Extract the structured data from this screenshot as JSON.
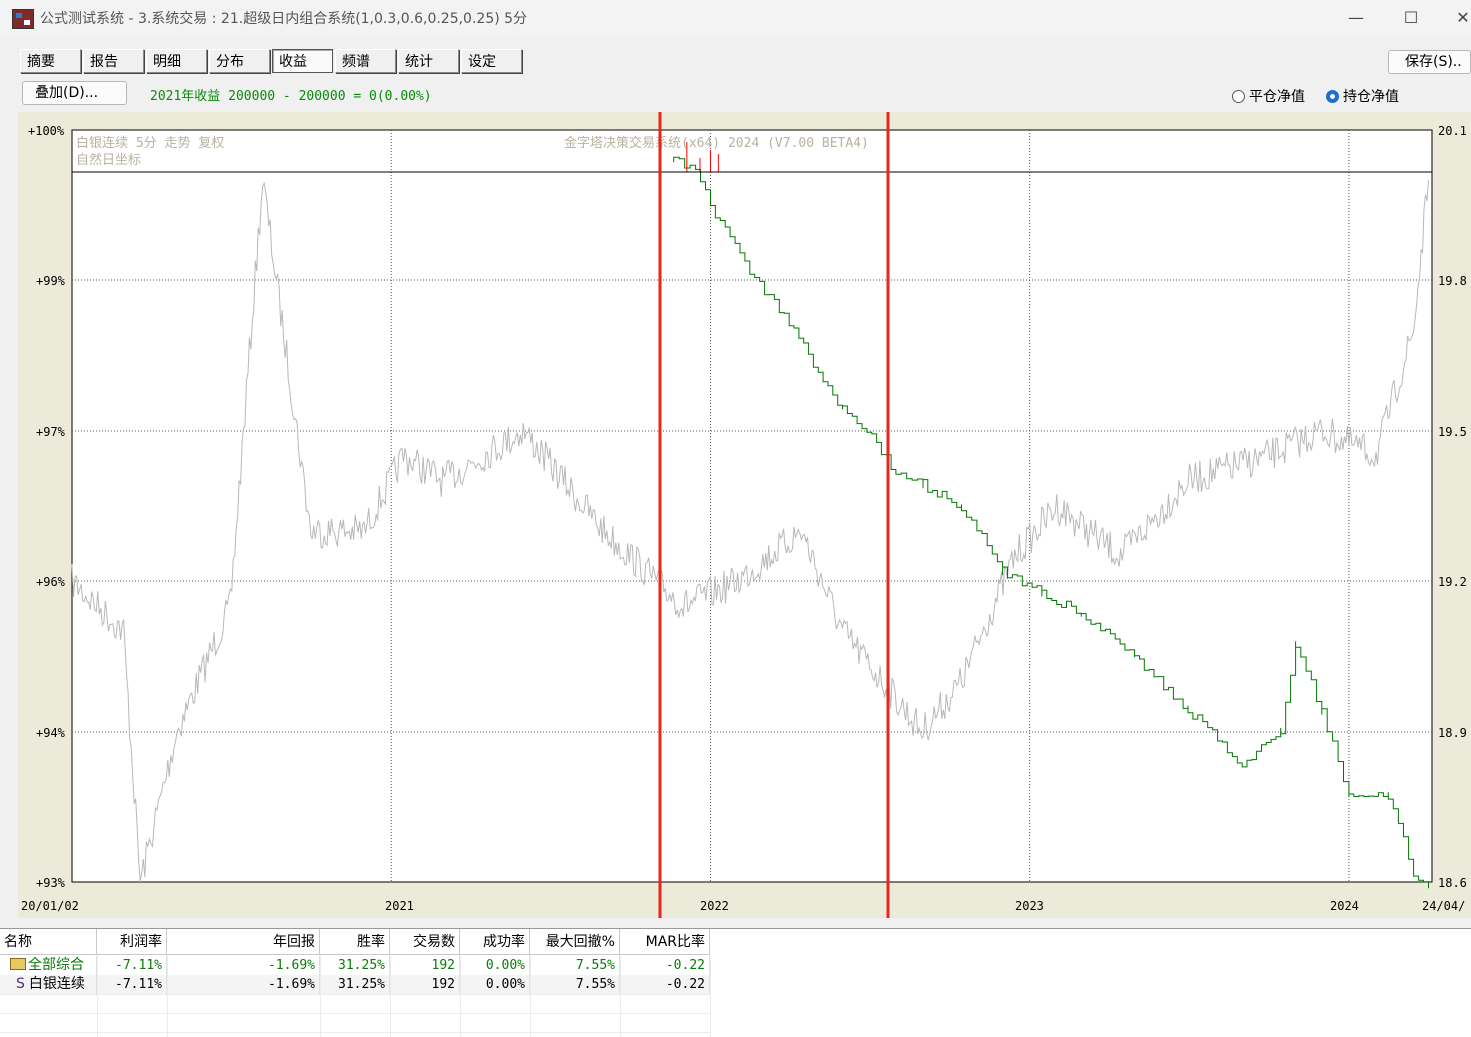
{
  "window": {
    "title": "公式测试系统 - 3.系统交易 : 21.超级日内组合系统(1,0.3,0.6,0.25,0.25) 5分"
  },
  "tabs": [
    {
      "label": "摘要",
      "active": false
    },
    {
      "label": "报告",
      "active": false
    },
    {
      "label": "明细",
      "active": false
    },
    {
      "label": "分布",
      "active": false
    },
    {
      "label": "收益",
      "active": true
    },
    {
      "label": "频谱",
      "active": false
    },
    {
      "label": "统计",
      "active": false
    },
    {
      "label": "设定",
      "active": false
    }
  ],
  "toolbar": {
    "save_label": "保存(S)..",
    "overlay_label": "叠加(D)...",
    "return_text": "2021年收益 200000 - 200000 = 0(0.00%)",
    "radio_close_label": "平仓净值",
    "radio_hold_label": "持仓净值",
    "radio_selected": "持仓净值"
  },
  "chart": {
    "watermark_line1": "白银连续 5分 走势 复权",
    "watermark_line2": "自然日坐标",
    "watermark_center": "金字塔决策交易系统(x64) 2024 (V7.00 BETA4)",
    "left_ticks": [
      "+100%",
      "+99%",
      "+97%",
      "+96%",
      "+94%",
      "+93%"
    ],
    "right_ticks": [
      "20.1",
      "19.8",
      "19.5",
      "19.2",
      "18.9",
      "18.6"
    ],
    "x_start": "20/01/02",
    "x_end": "24/04/",
    "x_ticks": [
      "2021",
      "2022",
      "2023",
      "2024"
    ],
    "colors": {
      "equity": "#007800",
      "price": "#b8b8b8",
      "highlight": "#e8261e",
      "spike": "#ff0000"
    }
  },
  "chart_data": {
    "type": "line",
    "series": [
      {
        "name": "equity (持仓净值)",
        "x": [
          "2021-11-20",
          "2021-12-15",
          "2022-01-01",
          "2022-02-15",
          "2022-04-01",
          "2022-06-01",
          "2022-07-10",
          "2022-08-01",
          "2022-09-01",
          "2022-10-15",
          "2022-12-01",
          "2023-01-15",
          "2023-03-01",
          "2023-05-01",
          "2023-07-01",
          "2023-09-01",
          "2023-10-15",
          "2023-11-01",
          "2023-12-01",
          "2024-01-01",
          "2024-02-15",
          "2024-03-15",
          "2024-04-01"
        ],
        "values": [
          99.7,
          99.65,
          99.3,
          98.7,
          98.2,
          97.4,
          97.1,
          96.8,
          96.7,
          96.5,
          95.9,
          95.7,
          95.5,
          95.1,
          94.6,
          94.1,
          94.4,
          95.2,
          94.6,
          93.8,
          93.8,
          93.1,
          92.9
        ]
      },
      {
        "name": "白银连续 (price)",
        "x": [
          "2020-01-02",
          "2020-03-01",
          "2020-03-20",
          "2020-05-01",
          "2020-07-01",
          "2020-08-07",
          "2020-10-01",
          "2020-12-01",
          "2021-01-15",
          "2021-03-01",
          "2021-06-01",
          "2021-09-01",
          "2021-12-01",
          "2022-02-01",
          "2022-04-15",
          "2022-06-01",
          "2022-08-31",
          "2022-10-15",
          "2022-12-15",
          "2023-02-01",
          "2023-04-15",
          "2023-07-01",
          "2023-10-01",
          "2023-12-01",
          "2024-02-01",
          "2024-03-15",
          "2024-04-01"
        ],
        "values": [
          19.2,
          19.1,
          18.6,
          18.9,
          19.15,
          20.0,
          19.3,
          19.3,
          19.45,
          19.4,
          19.5,
          19.3,
          19.15,
          19.2,
          19.3,
          19.1,
          18.9,
          19.0,
          19.25,
          19.35,
          19.25,
          19.4,
          19.45,
          19.5,
          19.45,
          19.7,
          20.0
        ]
      }
    ],
    "left_axis_label_values": [
      "+100%",
      "+99%",
      "+97%",
      "+96%",
      "+94%",
      "+93%"
    ],
    "right_axis_label_values": [
      20.1,
      19.8,
      19.5,
      19.2,
      18.9,
      18.6
    ],
    "xlim": [
      "2020/01/02",
      "2024/04"
    ],
    "grid": true
  },
  "table": {
    "headers": [
      "名称",
      "利润率",
      "年回报",
      "胜率",
      "交易数",
      "成功率",
      "最大回撤%",
      "MAR比率"
    ],
    "rows": [
      {
        "icon": "folder-icon",
        "name": "全部综合",
        "values": [
          "-7.11%",
          "-1.69%",
          "31.25%",
          "192",
          "0.00%",
          "7.55%",
          "-0.22"
        ]
      },
      {
        "icon": "s",
        "name": "白银连续",
        "values": [
          "-7.11%",
          "-1.69%",
          "31.25%",
          "192",
          "0.00%",
          "7.55%",
          "-0.22"
        ]
      }
    ]
  }
}
